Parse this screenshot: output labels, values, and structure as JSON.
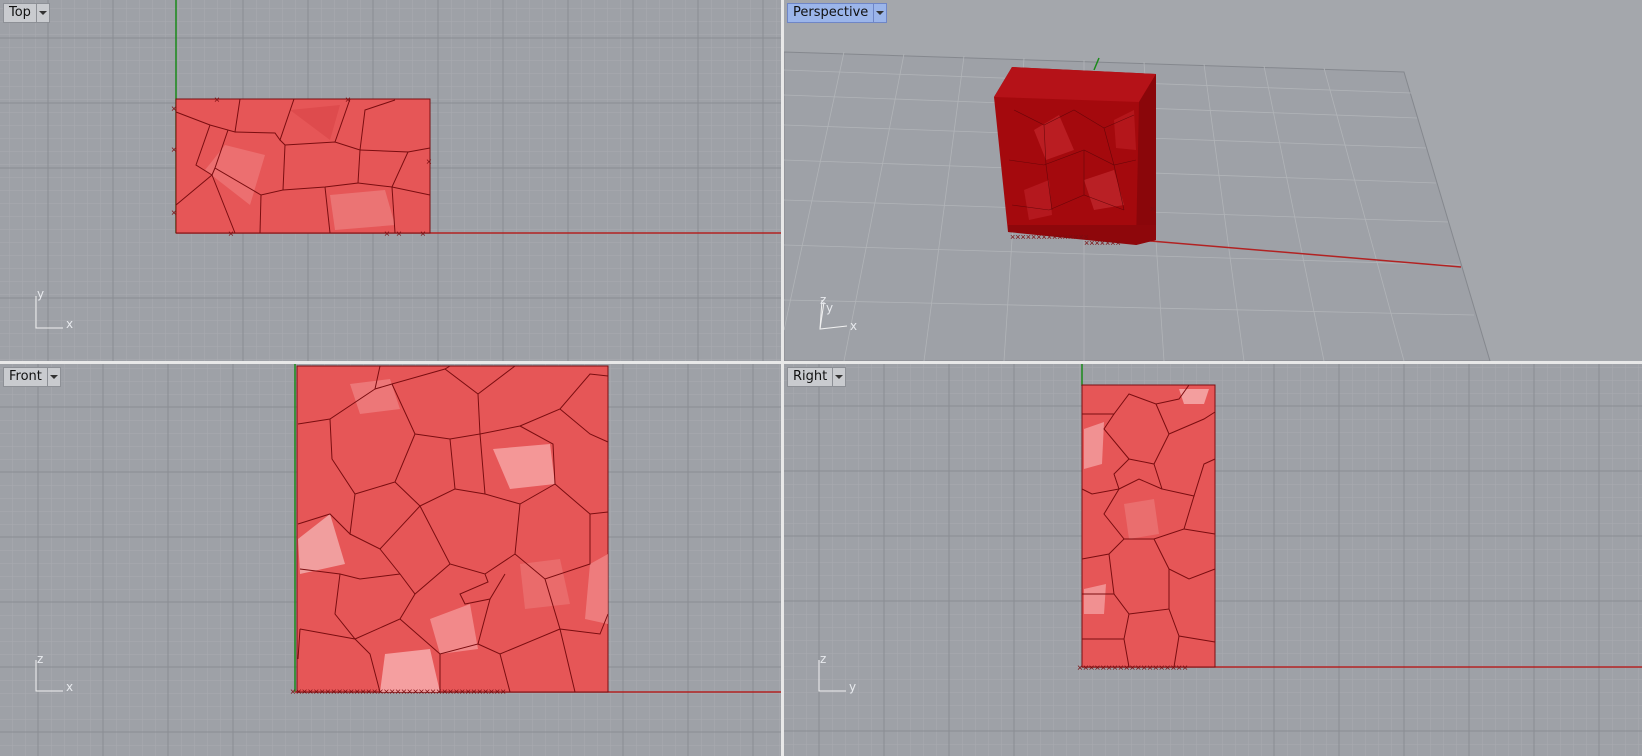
{
  "viewports": {
    "top": {
      "name": "Top",
      "axis_h": "x",
      "axis_v": "y"
    },
    "perspective": {
      "name": "Perspective",
      "axis_h": "x",
      "axis_v": "y",
      "axis_z": "z"
    },
    "front": {
      "name": "Front",
      "axis_h": "x",
      "axis_v": "z"
    },
    "right": {
      "name": "Right",
      "axis_h": "y",
      "axis_v": "z"
    }
  },
  "colors": {
    "background": "#9ea1a7",
    "grid_minor": "#a9acb1",
    "grid_major": "#8a8d93",
    "object_fill": "#e65657",
    "object_edge": "#7a0d10",
    "x_axis": "#b22222",
    "y_axis": "#1a8a1a",
    "active_label": "#9bb5ea"
  },
  "icons": [
    "viewport-menu-arrow-icon",
    "axis-triad-icon"
  ]
}
